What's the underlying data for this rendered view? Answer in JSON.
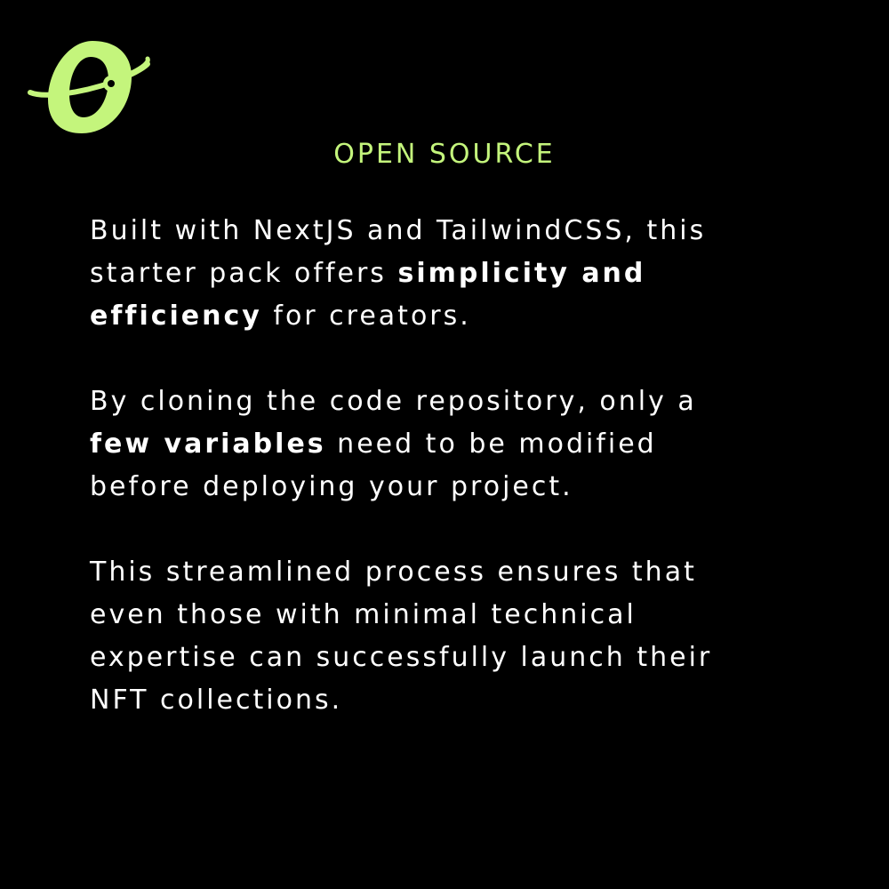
{
  "colors": {
    "background": "#000000",
    "accent": "#c4f57c",
    "text": "#ffffff"
  },
  "logo": {
    "icon": "orbit-o-logo-icon"
  },
  "heading": "OPEN SOURCE",
  "paragraphs": [
    {
      "lines": [
        [
          {
            "t": "Built with NextJS and TailwindCSS, this",
            "b": false
          }
        ],
        [
          {
            "t": "starter pack offers ",
            "b": false
          },
          {
            "t": "simplicity and",
            "b": true
          }
        ],
        [
          {
            "t": "efficiency",
            "b": true
          },
          {
            "t": " for creators.",
            "b": false
          }
        ]
      ]
    },
    {
      "lines": [
        [
          {
            "t": "By cloning the code repository, only a",
            "b": false
          }
        ],
        [
          {
            "t": "few variables",
            "b": true
          },
          {
            "t": " need to be modified",
            "b": false
          }
        ],
        [
          {
            "t": "before deploying your project.",
            "b": false
          }
        ]
      ]
    },
    {
      "lines": [
        [
          {
            "t": "This streamlined process ensures that",
            "b": false
          }
        ],
        [
          {
            "t": "even those with minimal technical",
            "b": false
          }
        ],
        [
          {
            "t": "expertise can successfully launch their",
            "b": false
          }
        ],
        [
          {
            "t": "NFT collections.",
            "b": false
          }
        ]
      ]
    }
  ]
}
